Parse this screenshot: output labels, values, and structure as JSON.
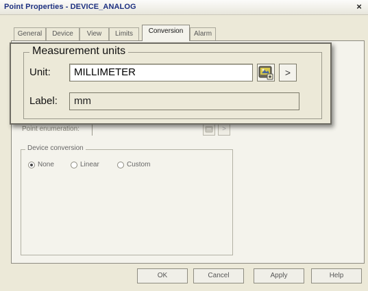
{
  "window": {
    "title": "Point Properties - DEVICE_ANALOG",
    "close_glyph": "×"
  },
  "tabs": [
    {
      "label": "General",
      "active": false
    },
    {
      "label": "Device",
      "active": false
    },
    {
      "label": "View",
      "active": false
    },
    {
      "label": "Limits",
      "active": false
    },
    {
      "label": "Conversion",
      "active": true
    },
    {
      "label": "Alarm",
      "active": false
    }
  ],
  "measurement_units": {
    "group_label": "Measurement units",
    "unit_label": "Unit:",
    "unit_value": "MILLIMETER",
    "browse_icon": "units-browse-icon",
    "more_glyph": ">",
    "label_label": "Label:",
    "label_value": "mm"
  },
  "point_enumeration": {
    "label": "Point enumeration:",
    "value": "",
    "browse_icon": "enumeration-browse-icon",
    "more_glyph": ">"
  },
  "device_conversion": {
    "group_label": "Device conversion",
    "options": [
      {
        "label": "None",
        "selected": true
      },
      {
        "label": "Linear",
        "selected": false
      },
      {
        "label": "Custom",
        "selected": false
      }
    ]
  },
  "buttons": {
    "ok": "OK",
    "cancel": "Cancel",
    "apply": "Apply",
    "help": "Help"
  }
}
